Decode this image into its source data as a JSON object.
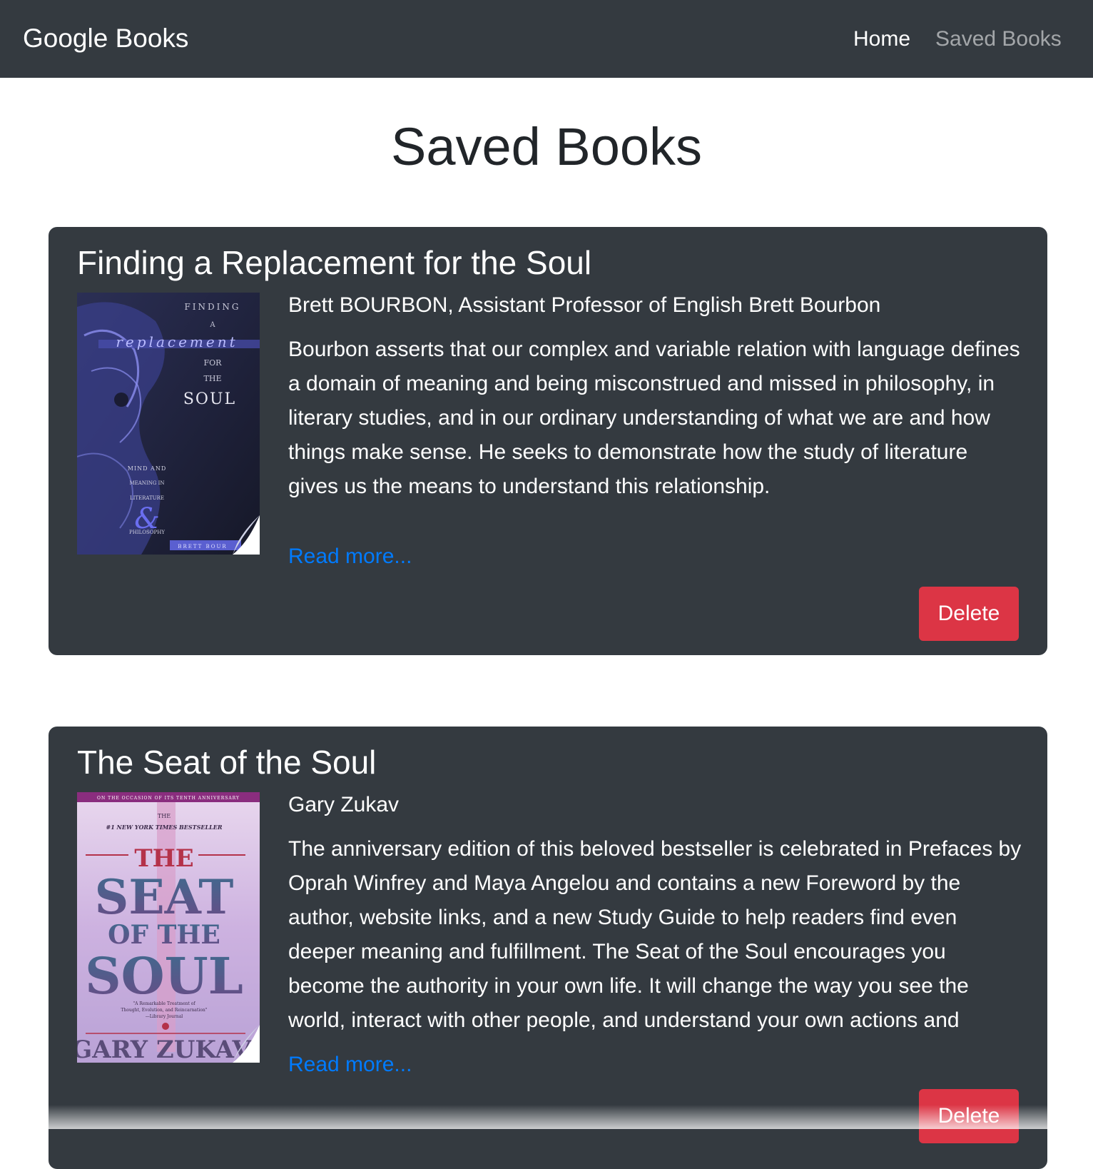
{
  "navbar": {
    "brand": "Google Books",
    "links": [
      "Home",
      "Saved Books"
    ]
  },
  "page": {
    "title": "Saved Books"
  },
  "books": [
    {
      "title": "Finding a Replacement for the Soul",
      "authors": "Brett BOURBON, Assistant Professor of English Brett Bourbon",
      "description": "Bourbon asserts that our complex and variable relation with language defines a domain of meaning and being misconstrued and missed in philosophy, in literary studies, and in our ordinary understanding of what we are and how things make sense. He seeks to demonstrate how the study of literature gives us the means to understand this relationship.",
      "read_more": "Read more...",
      "delete_label": "Delete",
      "cover": {
        "top_lines": [
          "FINDING",
          "A"
        ],
        "script_word": "replacement",
        "lines": [
          "FOR",
          "THE"
        ],
        "big_word": "SOUL",
        "side_lines": [
          "MIND AND",
          "MEANING IN",
          "LITERATURE"
        ],
        "ampersand": "&",
        "bottom_line": "PHILOSOPHY",
        "author_strip": "BRETT BOUR"
      }
    },
    {
      "title": "The Seat of the Soul",
      "authors": "Gary Zukav",
      "description": "The anniversary edition of this beloved bestseller is celebrated in Prefaces by Oprah Winfrey and Maya Angelou and contains a new Foreword by the author, website links, and a new Study Guide to help readers find even deeper meaning and fulfillment. The Seat of the Soul encourages you become the authority in your own life. It will change the way you see the world, interact with other people, and understand your own actions and",
      "read_more": "Read more...",
      "delete_label": "Delete",
      "cover": {
        "banner": "ON THE OCCASION OF ITS TENTH ANNIVERSARY",
        "small": "THE",
        "bestseller": "#1 NEW YORK TIMES BESTSELLER",
        "word1": "THE",
        "word2": "SEAT",
        "word3": "OF THE",
        "word4": "SOUL",
        "quote1": "\"A Remarkable Treatment of",
        "quote2": "Thought, Evolution, and Reincarnation\"",
        "quote3": "—Library Journal",
        "author": "GARY ZUKAV"
      }
    }
  ]
}
